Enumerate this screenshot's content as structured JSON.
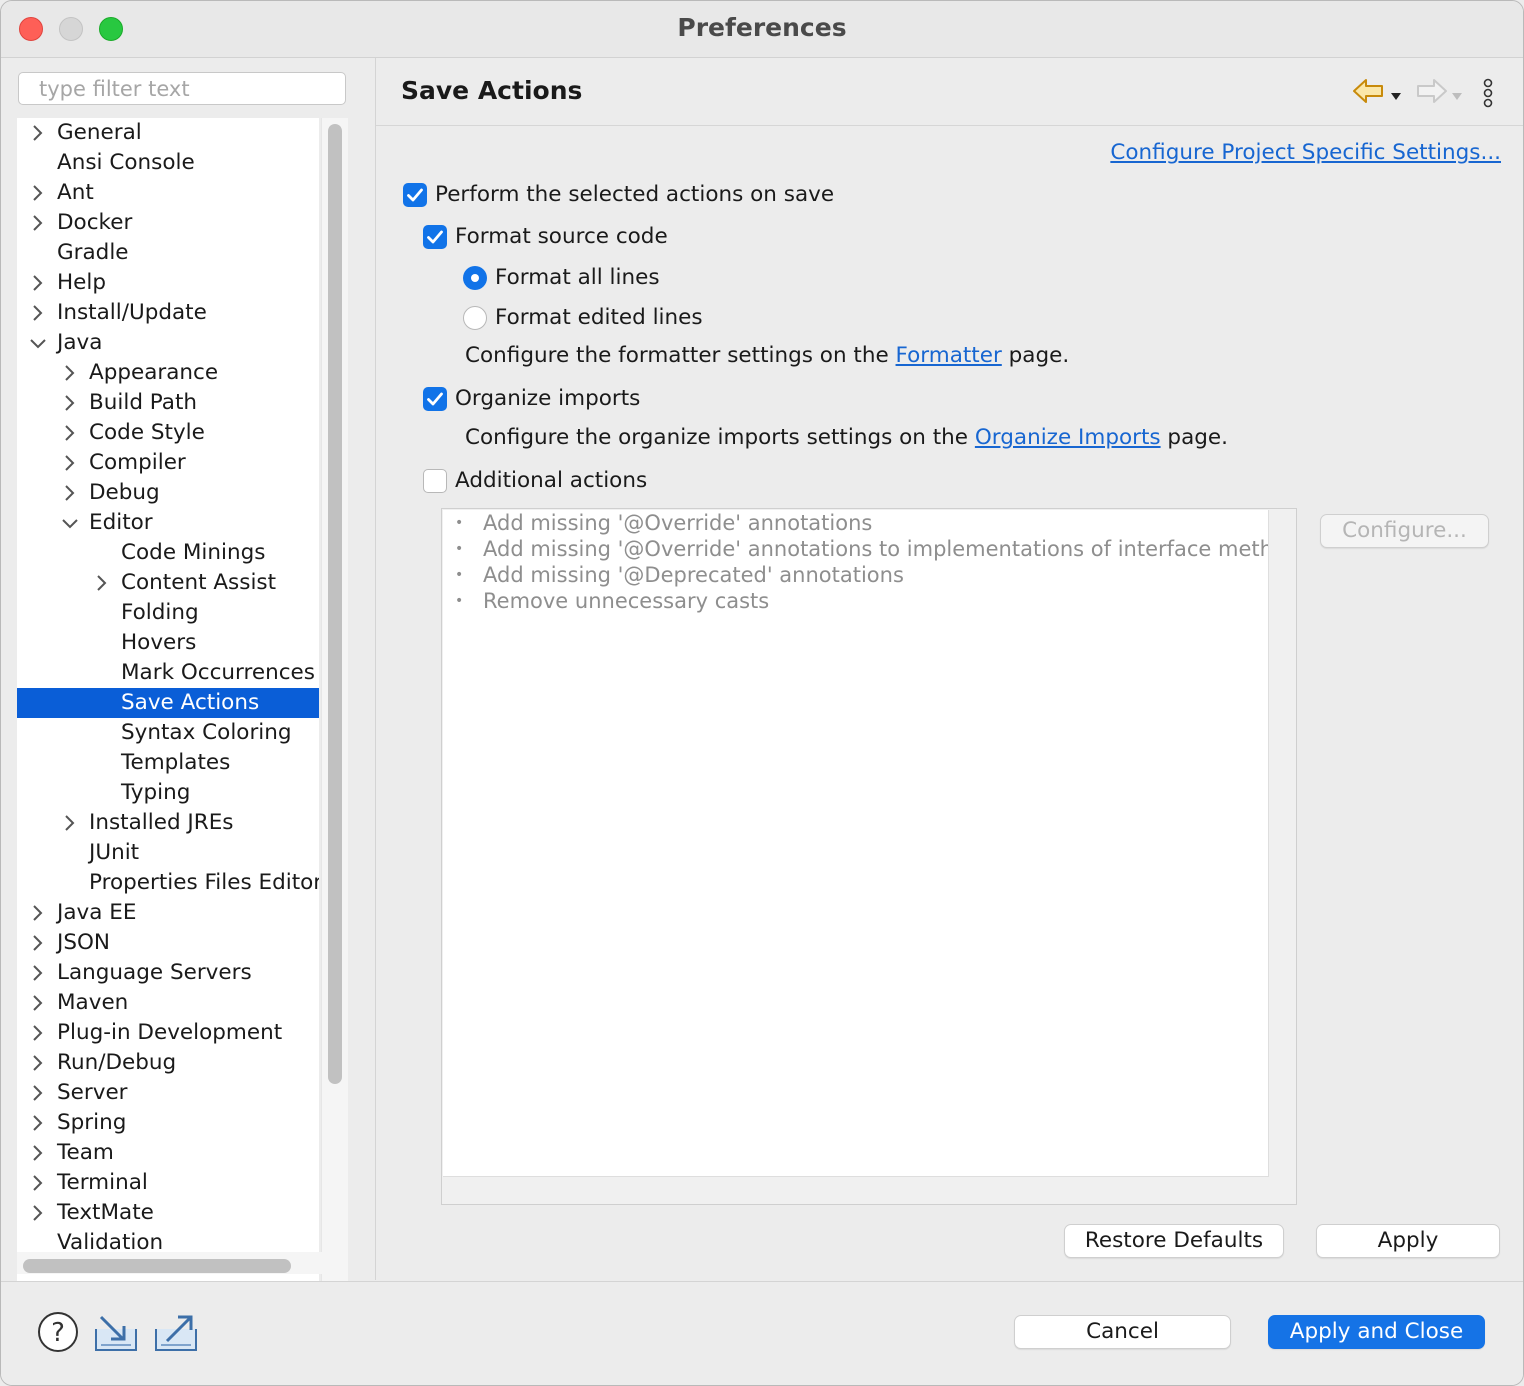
{
  "window": {
    "title": "Preferences"
  },
  "filter": {
    "placeholder": "type filter text"
  },
  "tree": [
    {
      "label": "General",
      "level": 0,
      "expandable": true,
      "expanded": false
    },
    {
      "label": "Ansi Console",
      "level": 0,
      "expandable": false
    },
    {
      "label": "Ant",
      "level": 0,
      "expandable": true,
      "expanded": false
    },
    {
      "label": "Docker",
      "level": 0,
      "expandable": true,
      "expanded": false
    },
    {
      "label": "Gradle",
      "level": 0,
      "expandable": false
    },
    {
      "label": "Help",
      "level": 0,
      "expandable": true,
      "expanded": false
    },
    {
      "label": "Install/Update",
      "level": 0,
      "expandable": true,
      "expanded": false
    },
    {
      "label": "Java",
      "level": 0,
      "expandable": true,
      "expanded": true
    },
    {
      "label": "Appearance",
      "level": 1,
      "expandable": true,
      "expanded": false
    },
    {
      "label": "Build Path",
      "level": 1,
      "expandable": true,
      "expanded": false
    },
    {
      "label": "Code Style",
      "level": 1,
      "expandable": true,
      "expanded": false
    },
    {
      "label": "Compiler",
      "level": 1,
      "expandable": true,
      "expanded": false
    },
    {
      "label": "Debug",
      "level": 1,
      "expandable": true,
      "expanded": false
    },
    {
      "label": "Editor",
      "level": 1,
      "expandable": true,
      "expanded": true
    },
    {
      "label": "Code Minings",
      "level": 2,
      "expandable": false
    },
    {
      "label": "Content Assist",
      "level": 2,
      "expandable": true,
      "expanded": false
    },
    {
      "label": "Folding",
      "level": 2,
      "expandable": false
    },
    {
      "label": "Hovers",
      "level": 2,
      "expandable": false
    },
    {
      "label": "Mark Occurrences",
      "level": 2,
      "expandable": false
    },
    {
      "label": "Save Actions",
      "level": 2,
      "expandable": false,
      "selected": true
    },
    {
      "label": "Syntax Coloring",
      "level": 2,
      "expandable": false
    },
    {
      "label": "Templates",
      "level": 2,
      "expandable": false
    },
    {
      "label": "Typing",
      "level": 2,
      "expandable": false
    },
    {
      "label": "Installed JREs",
      "level": 1,
      "expandable": true,
      "expanded": false
    },
    {
      "label": "JUnit",
      "level": 1,
      "expandable": false
    },
    {
      "label": "Properties Files Editor",
      "level": 1,
      "expandable": false
    },
    {
      "label": "Java EE",
      "level": 0,
      "expandable": true,
      "expanded": false
    },
    {
      "label": "JSON",
      "level": 0,
      "expandable": true,
      "expanded": false
    },
    {
      "label": "Language Servers",
      "level": 0,
      "expandable": true,
      "expanded": false
    },
    {
      "label": "Maven",
      "level": 0,
      "expandable": true,
      "expanded": false
    },
    {
      "label": "Plug-in Development",
      "level": 0,
      "expandable": true,
      "expanded": false
    },
    {
      "label": "Run/Debug",
      "level": 0,
      "expandable": true,
      "expanded": false
    },
    {
      "label": "Server",
      "level": 0,
      "expandable": true,
      "expanded": false
    },
    {
      "label": "Spring",
      "level": 0,
      "expandable": true,
      "expanded": false
    },
    {
      "label": "Team",
      "level": 0,
      "expandable": true,
      "expanded": false
    },
    {
      "label": "Terminal",
      "level": 0,
      "expandable": true,
      "expanded": false
    },
    {
      "label": "TextMate",
      "level": 0,
      "expandable": true,
      "expanded": false
    },
    {
      "label": "Validation",
      "level": 0,
      "expandable": false
    }
  ],
  "page": {
    "title": "Save Actions",
    "project_link": "Configure Project Specific Settings...",
    "perform_on_save": {
      "label": "Perform the selected actions on save",
      "checked": true
    },
    "format_source": {
      "label": "Format source code",
      "checked": true
    },
    "format_all": {
      "label": "Format all lines",
      "selected": true
    },
    "format_edited": {
      "label": "Format edited lines",
      "selected": false
    },
    "formatter_info": {
      "before": "Configure the formatter settings on the ",
      "link": "Formatter",
      "after": " page."
    },
    "organize_imports": {
      "label": "Organize imports",
      "checked": true
    },
    "organize_info": {
      "before": "Configure the organize imports settings on the ",
      "link": "Organize Imports",
      "after": " page."
    },
    "additional_actions": {
      "label": "Additional actions",
      "checked": false
    },
    "additional_list": [
      "Add missing '@Override' annotations",
      "Add missing '@Override' annotations to implementations of interface methods",
      "Add missing '@Deprecated' annotations",
      "Remove unnecessary casts"
    ],
    "configure_button": "Configure...",
    "restore_defaults": "Restore Defaults",
    "apply": "Apply"
  },
  "footer": {
    "cancel": "Cancel",
    "apply_close": "Apply and Close"
  },
  "icons": {
    "help": "help-icon",
    "import": "import-icon",
    "export": "export-icon",
    "back": "back-arrow-icon",
    "forward": "forward-arrow-icon",
    "more": "more-vertical-icon"
  },
  "colors": {
    "accent": "#1173e8",
    "selection": "#0a5ed7",
    "link": "#1766d1",
    "back_arrow": "#d89a12"
  }
}
